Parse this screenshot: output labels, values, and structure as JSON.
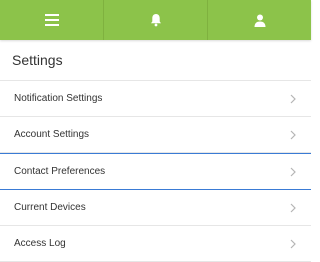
{
  "colors": {
    "topbar": "#8cc34a",
    "icon": "#ffffff",
    "active_highlight": "#3a7bd5"
  },
  "topbar": {
    "tabs": [
      {
        "icon": "hamburger-menu-icon"
      },
      {
        "icon": "bell-icon"
      },
      {
        "icon": "user-icon"
      }
    ]
  },
  "page": {
    "title": "Settings"
  },
  "menu": {
    "items": [
      {
        "label": "Notification Settings",
        "icon": "chevron-right-icon"
      },
      {
        "label": "Account Settings",
        "icon": "chevron-right-icon"
      },
      {
        "label": "Contact Preferences",
        "icon": "chevron-right-icon",
        "highlighted": true
      },
      {
        "label": "Current Devices",
        "icon": "chevron-right-icon"
      },
      {
        "label": "Access Log",
        "icon": "chevron-right-icon"
      }
    ]
  }
}
